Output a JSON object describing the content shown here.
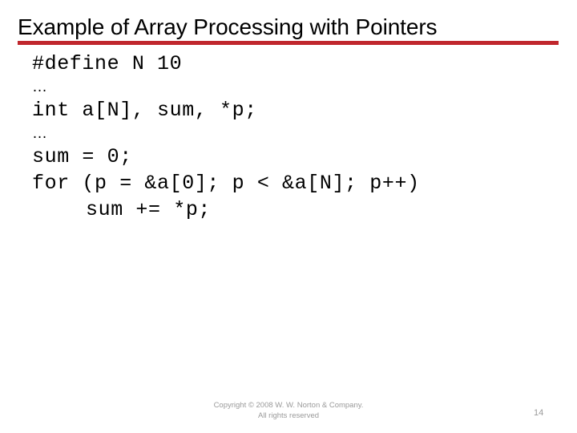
{
  "slide": {
    "title": "Example of Array Processing with Pointers",
    "accent_color": "#C0272D",
    "background_color": "#FFFFFF",
    "text_color": "#000000",
    "footer_color": "#9A9A9A"
  },
  "code": {
    "lines": [
      {
        "text": "#define N 10",
        "kind": "code",
        "indent": false
      },
      {
        "text": "…",
        "kind": "ellipsis",
        "indent": false
      },
      {
        "text": "int a[N], sum, *p;",
        "kind": "code",
        "indent": false
      },
      {
        "text": "…",
        "kind": "ellipsis",
        "indent": false
      },
      {
        "text": "sum = 0;",
        "kind": "code",
        "indent": false
      },
      {
        "text": "for (p = &a[0]; p < &a[N]; p++)",
        "kind": "code",
        "indent": false
      },
      {
        "text": "sum += *p;",
        "kind": "code",
        "indent": true
      }
    ]
  },
  "footer": {
    "copyright_line1": "Copyright © 2008 W. W. Norton & Company.",
    "copyright_line2": "All rights reserved",
    "page_number": "14"
  }
}
